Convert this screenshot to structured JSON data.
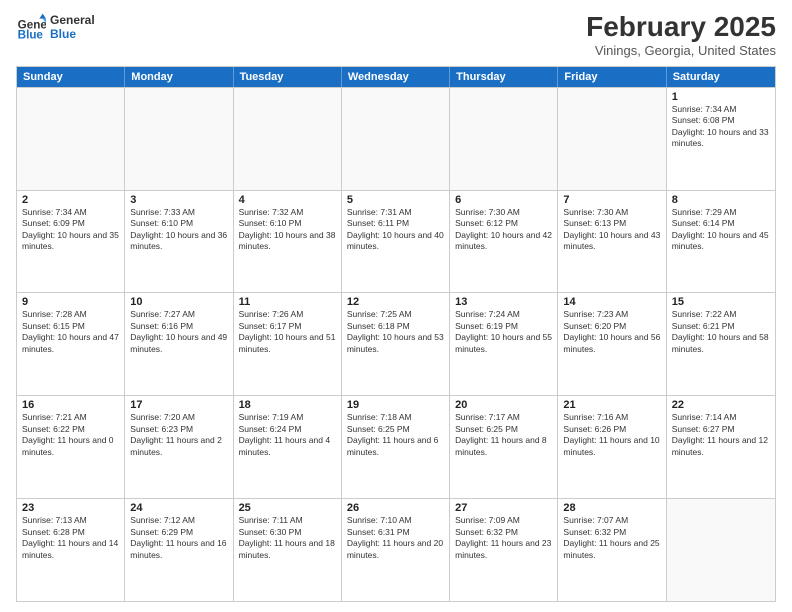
{
  "header": {
    "logo_line1": "General",
    "logo_line2": "Blue",
    "title": "February 2025",
    "subtitle": "Vinings, Georgia, United States"
  },
  "days_of_week": [
    "Sunday",
    "Monday",
    "Tuesday",
    "Wednesday",
    "Thursday",
    "Friday",
    "Saturday"
  ],
  "weeks": [
    [
      {
        "day": "",
        "text": ""
      },
      {
        "day": "",
        "text": ""
      },
      {
        "day": "",
        "text": ""
      },
      {
        "day": "",
        "text": ""
      },
      {
        "day": "",
        "text": ""
      },
      {
        "day": "",
        "text": ""
      },
      {
        "day": "1",
        "text": "Sunrise: 7:34 AM\nSunset: 6:08 PM\nDaylight: 10 hours and 33 minutes."
      }
    ],
    [
      {
        "day": "2",
        "text": "Sunrise: 7:34 AM\nSunset: 6:09 PM\nDaylight: 10 hours and 35 minutes."
      },
      {
        "day": "3",
        "text": "Sunrise: 7:33 AM\nSunset: 6:10 PM\nDaylight: 10 hours and 36 minutes."
      },
      {
        "day": "4",
        "text": "Sunrise: 7:32 AM\nSunset: 6:10 PM\nDaylight: 10 hours and 38 minutes."
      },
      {
        "day": "5",
        "text": "Sunrise: 7:31 AM\nSunset: 6:11 PM\nDaylight: 10 hours and 40 minutes."
      },
      {
        "day": "6",
        "text": "Sunrise: 7:30 AM\nSunset: 6:12 PM\nDaylight: 10 hours and 42 minutes."
      },
      {
        "day": "7",
        "text": "Sunrise: 7:30 AM\nSunset: 6:13 PM\nDaylight: 10 hours and 43 minutes."
      },
      {
        "day": "8",
        "text": "Sunrise: 7:29 AM\nSunset: 6:14 PM\nDaylight: 10 hours and 45 minutes."
      }
    ],
    [
      {
        "day": "9",
        "text": "Sunrise: 7:28 AM\nSunset: 6:15 PM\nDaylight: 10 hours and 47 minutes."
      },
      {
        "day": "10",
        "text": "Sunrise: 7:27 AM\nSunset: 6:16 PM\nDaylight: 10 hours and 49 minutes."
      },
      {
        "day": "11",
        "text": "Sunrise: 7:26 AM\nSunset: 6:17 PM\nDaylight: 10 hours and 51 minutes."
      },
      {
        "day": "12",
        "text": "Sunrise: 7:25 AM\nSunset: 6:18 PM\nDaylight: 10 hours and 53 minutes."
      },
      {
        "day": "13",
        "text": "Sunrise: 7:24 AM\nSunset: 6:19 PM\nDaylight: 10 hours and 55 minutes."
      },
      {
        "day": "14",
        "text": "Sunrise: 7:23 AM\nSunset: 6:20 PM\nDaylight: 10 hours and 56 minutes."
      },
      {
        "day": "15",
        "text": "Sunrise: 7:22 AM\nSunset: 6:21 PM\nDaylight: 10 hours and 58 minutes."
      }
    ],
    [
      {
        "day": "16",
        "text": "Sunrise: 7:21 AM\nSunset: 6:22 PM\nDaylight: 11 hours and 0 minutes."
      },
      {
        "day": "17",
        "text": "Sunrise: 7:20 AM\nSunset: 6:23 PM\nDaylight: 11 hours and 2 minutes."
      },
      {
        "day": "18",
        "text": "Sunrise: 7:19 AM\nSunset: 6:24 PM\nDaylight: 11 hours and 4 minutes."
      },
      {
        "day": "19",
        "text": "Sunrise: 7:18 AM\nSunset: 6:25 PM\nDaylight: 11 hours and 6 minutes."
      },
      {
        "day": "20",
        "text": "Sunrise: 7:17 AM\nSunset: 6:25 PM\nDaylight: 11 hours and 8 minutes."
      },
      {
        "day": "21",
        "text": "Sunrise: 7:16 AM\nSunset: 6:26 PM\nDaylight: 11 hours and 10 minutes."
      },
      {
        "day": "22",
        "text": "Sunrise: 7:14 AM\nSunset: 6:27 PM\nDaylight: 11 hours and 12 minutes."
      }
    ],
    [
      {
        "day": "23",
        "text": "Sunrise: 7:13 AM\nSunset: 6:28 PM\nDaylight: 11 hours and 14 minutes."
      },
      {
        "day": "24",
        "text": "Sunrise: 7:12 AM\nSunset: 6:29 PM\nDaylight: 11 hours and 16 minutes."
      },
      {
        "day": "25",
        "text": "Sunrise: 7:11 AM\nSunset: 6:30 PM\nDaylight: 11 hours and 18 minutes."
      },
      {
        "day": "26",
        "text": "Sunrise: 7:10 AM\nSunset: 6:31 PM\nDaylight: 11 hours and 20 minutes."
      },
      {
        "day": "27",
        "text": "Sunrise: 7:09 AM\nSunset: 6:32 PM\nDaylight: 11 hours and 23 minutes."
      },
      {
        "day": "28",
        "text": "Sunrise: 7:07 AM\nSunset: 6:32 PM\nDaylight: 11 hours and 25 minutes."
      },
      {
        "day": "",
        "text": ""
      }
    ]
  ]
}
